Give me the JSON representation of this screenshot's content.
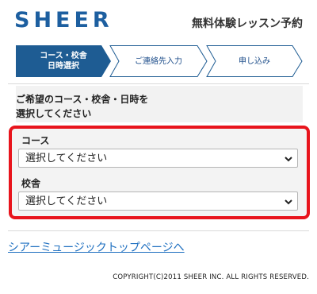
{
  "header": {
    "logo": "SHEER",
    "title": "無料体験レッスン予約"
  },
  "steps": [
    {
      "line1": "コース・校舎",
      "line2": "日時選択",
      "active": true
    },
    {
      "line1": "ご連絡先入力",
      "line2": "",
      "active": false
    },
    {
      "line1": "申し込み",
      "line2": "",
      "active": false
    }
  ],
  "instruction": {
    "line1": "ご希望のコース・校舎・日時を",
    "line2": "選択してください"
  },
  "form": {
    "course_label": "コース",
    "course_value": "選択してください",
    "school_label": "校舎",
    "school_value": "選択してください"
  },
  "footer": {
    "top_link": "シアーミュージックトップページへ",
    "copyright": "COPYRIGHT(C)2011 SHEER INC. ALL RIGHTS RESERVED."
  },
  "colors": {
    "brand": "#1d5fa0",
    "active_step": "#1e5c93",
    "highlight_border": "#e8141c",
    "link": "#1e6fc0"
  }
}
